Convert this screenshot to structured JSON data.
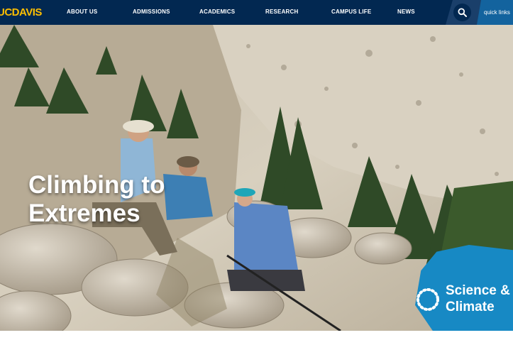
{
  "header": {
    "logo_text": "UCDAVIS",
    "nav": [
      {
        "label": "ABOUT US"
      },
      {
        "label": "ADMISSIONS"
      },
      {
        "label": "ACADEMICS"
      },
      {
        "label": "RESEARCH"
      },
      {
        "label": "CAMPUS LIFE"
      },
      {
        "label": "NEWS"
      }
    ],
    "search_icon": "search-icon",
    "quick_links_label": "quick links"
  },
  "hero": {
    "title_line1": "Climbing to",
    "title_line2": "Extremes",
    "badge": {
      "line1": "Science &",
      "line2": "Climate",
      "icon": "dotted-circle-icon"
    }
  },
  "colors": {
    "navy": "#022851",
    "gold": "#FFBF00",
    "quick_links_blue": "#13639e",
    "badge_blue": "#1789c4"
  }
}
